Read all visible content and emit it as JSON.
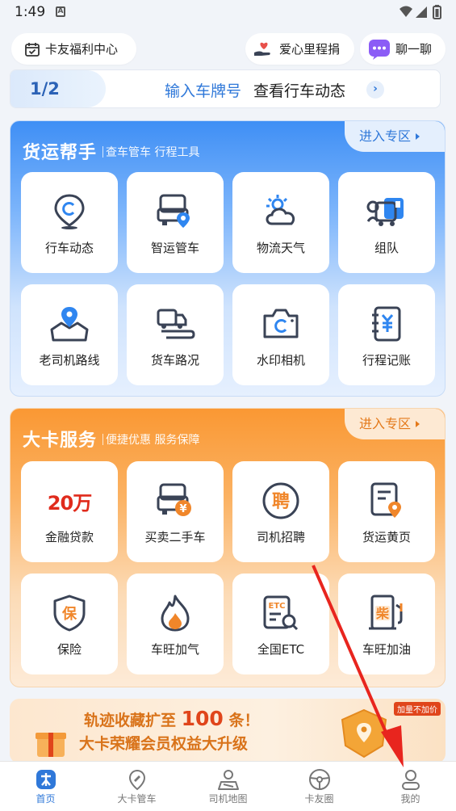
{
  "status": {
    "time": "1:49",
    "notif": "A"
  },
  "top": {
    "welfare": "卡友福利中心",
    "donate": "爱心里程捐",
    "chat": "聊一聊"
  },
  "plate": {
    "page": "1/2",
    "input_label": "输入车牌号",
    "action": "查看行车动态"
  },
  "freight": {
    "title": "货运帮手",
    "subtitle": "查车管车 行程工具",
    "enter": "进入专区",
    "items": [
      {
        "label": "行车动态",
        "icon": "location-c-icon"
      },
      {
        "label": "智运管车",
        "icon": "truck-location-icon"
      },
      {
        "label": "物流天气",
        "icon": "weather-icon"
      },
      {
        "label": "组队",
        "icon": "team-truck-icon"
      },
      {
        "label": "老司机路线",
        "icon": "route-map-icon"
      },
      {
        "label": "货车路况",
        "icon": "road-truck-icon"
      },
      {
        "label": "水印相机",
        "icon": "camera-icon"
      },
      {
        "label": "行程记账",
        "icon": "ledger-icon"
      }
    ]
  },
  "service": {
    "title": "大卡服务",
    "subtitle": "便捷优惠 服务保障",
    "enter": "进入专区",
    "items": [
      {
        "label": "金融贷款",
        "icon": "loan-icon",
        "badge": "20万"
      },
      {
        "label": "买卖二手车",
        "icon": "used-truck-icon"
      },
      {
        "label": "司机招聘",
        "icon": "recruit-icon",
        "glyph": "聘"
      },
      {
        "label": "货运黄页",
        "icon": "yellow-pages-icon"
      },
      {
        "label": "保险",
        "icon": "insurance-icon",
        "glyph": "保"
      },
      {
        "label": "车旺加气",
        "icon": "gas-flame-icon"
      },
      {
        "label": "全国ETC",
        "icon": "etc-icon",
        "glyph": "ETC"
      },
      {
        "label": "车旺加油",
        "icon": "fuel-icon",
        "glyph": "柴"
      }
    ]
  },
  "promo": {
    "line1_a": "轨迹收藏扩至",
    "line1_num": "100",
    "line1_b": "条！",
    "line2": "大卡荣耀会员权益大升级",
    "tag": "加量不加价"
  },
  "tabs": [
    {
      "label": "首页",
      "icon": "home-icon",
      "active": true
    },
    {
      "label": "大卡管车",
      "icon": "manage-truck-icon"
    },
    {
      "label": "司机地图",
      "icon": "driver-map-icon"
    },
    {
      "label": "卡友圈",
      "icon": "circle-icon"
    },
    {
      "label": "我的",
      "icon": "profile-icon"
    }
  ],
  "colors": {
    "blue": "#3f8ff5",
    "orange": "#fa9833",
    "icon_dark": "#3a4356",
    "icon_blue": "#2f86f0",
    "icon_orange": "#f0862a",
    "annotation_red": "#e8251e"
  }
}
